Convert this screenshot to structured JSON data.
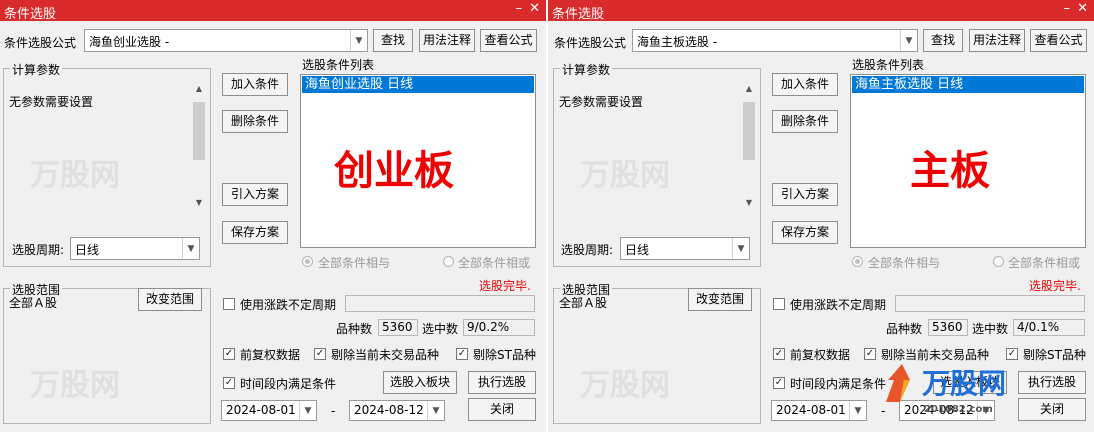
{
  "dialogs": [
    {
      "title": "条件选股",
      "formula_label": "条件选股公式",
      "formula_value": "海鱼创业选股  -",
      "buttons": {
        "find": "查找",
        "usage": "用法注释",
        "view": "查看公式",
        "add": "加入条件",
        "del": "删除条件",
        "import": "引入方案",
        "save": "保存方案",
        "range": "改变范围",
        "to_block": "选股入板块",
        "execute": "执行选股",
        "close": "关闭"
      },
      "calc_group": "计算参数",
      "no_param": "无参数需要设置",
      "period_label": "选股周期:",
      "period_value": "日线",
      "cond_list_label": "选股条件列表",
      "cond_item": "海鱼创业选股  日线",
      "big_label": "创业板",
      "radio_all": "全部条件相与",
      "radio_or": "全部条件相或",
      "status": "选股完毕.",
      "range_group": "选股范围",
      "range_value": "全部Ａ股",
      "use_rise_fall": "使用涨跌不定周期",
      "count_label": "品种数",
      "count_value": "5360",
      "hit_label": "选中数",
      "hit_value": "9/0.2%",
      "opt_fq": "前复权数据",
      "opt_exclude_untraded": "剔除当前未交易品种",
      "opt_exclude_st": "剔除ST品种",
      "opt_time_range": "时间段内满足条件",
      "date_start": "2024-08-01",
      "date_sep": "-",
      "date_end": "2024-08-12",
      "watermark": "万股网"
    },
    {
      "title": "条件选股",
      "formula_label": "条件选股公式",
      "formula_value": "海鱼主板选股  -",
      "buttons": {
        "find": "查找",
        "usage": "用法注释",
        "view": "查看公式",
        "add": "加入条件",
        "del": "删除条件",
        "import": "引入方案",
        "save": "保存方案",
        "range": "改变范围",
        "to_block": "选股入板块",
        "execute": "执行选股",
        "close": "关闭"
      },
      "calc_group": "计算参数",
      "no_param": "无参数需要设置",
      "period_label": "选股周期:",
      "period_value": "日线",
      "cond_list_label": "选股条件列表",
      "cond_item": "海鱼主板选股  日线",
      "big_label": "主板",
      "radio_all": "全部条件相与",
      "radio_or": "全部条件相或",
      "status": "选股完毕.",
      "range_group": "选股范围",
      "range_value": "全部Ａ股",
      "use_rise_fall": "使用涨跌不定周期",
      "count_label": "品种数",
      "count_value": "5360",
      "hit_label": "选中数",
      "hit_value": "4/0.1%",
      "opt_fq": "前复权数据",
      "opt_exclude_untraded": "剔除当前未交易品种",
      "opt_exclude_st": "剔除ST品种",
      "opt_time_range": "时间段内满足条件",
      "date_start": "2024-08-01",
      "date_sep": "-",
      "date_end": "2024-08-12",
      "watermark": "万股网"
    }
  ],
  "overlay_logo": {
    "text": "万股网",
    "url": "201082.com"
  },
  "colors": {
    "titlebar": "#d92b2b",
    "selection": "#0078d7",
    "big_label": "#ee0000",
    "status": "#ee0000"
  }
}
